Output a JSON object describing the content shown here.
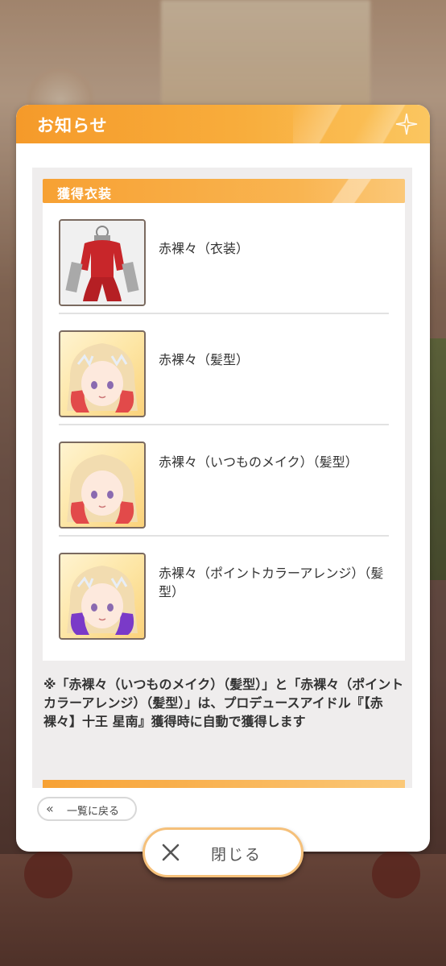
{
  "modal": {
    "title": "お知らせ",
    "section_title": "獲得衣装",
    "items": [
      {
        "label": "赤裸々（衣装）",
        "icon": "costume-icon"
      },
      {
        "label": "赤裸々（髪型）",
        "icon": "hairstyle-icon"
      },
      {
        "label": "赤裸々（いつものメイク）（髪型）",
        "icon": "hairstyle-icon"
      },
      {
        "label": "赤裸々（ポイントカラーアレンジ）（髪型）",
        "icon": "hairstyle-icon"
      }
    ],
    "note": "※「赤裸々（いつものメイク）（髪型）」と「赤裸々（ポイントカラーアレンジ）（髪型）」は、プロデュースアイドル『【赤裸々】十王 星南』獲得時に自動で獲得します",
    "back_label": "一覧に戻る",
    "close_label": "閉じる"
  },
  "colors": {
    "accent_orange": "#f59a2a",
    "panel_bg": "#efeded"
  }
}
